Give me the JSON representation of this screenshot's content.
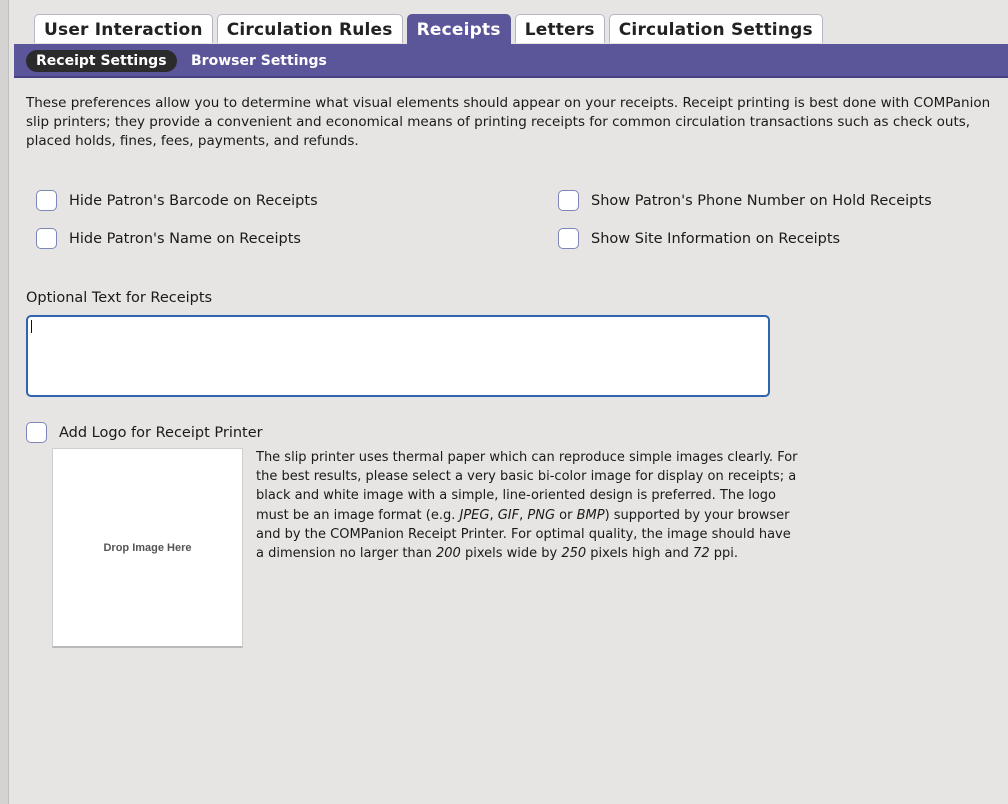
{
  "tabs": [
    "User Interaction",
    "Circulation Rules",
    "Receipts",
    "Letters",
    "Circulation Settings"
  ],
  "active_tab": "Receipts",
  "subtabs": [
    "Receipt Settings",
    "Browser Settings"
  ],
  "active_subtab": "Receipt Settings",
  "description": "These preferences allow you to determine what visual elements should appear on your receipts. Receipt printing is best done with COMPanion slip printers; they provide a convenient and economical means of printing receipts for common circulation transactions such as check outs, placed holds, fines, fees, payments, and refunds.",
  "options": {
    "hide_barcode": "Hide Patron's Barcode on Receipts",
    "hide_name": "Hide Patron's Name on Receipts",
    "show_phone": "Show Patron's Phone Number on Hold Receipts",
    "show_site": "Show Site Information on Receipts"
  },
  "optional_text": {
    "label": "Optional Text for Receipts",
    "value": ""
  },
  "logo": {
    "label": "Add Logo for Receipt Printer",
    "dropzone": "Drop Image Here",
    "help": {
      "t1": "The slip printer uses thermal paper which can reproduce simple images clearly. For the best results, please select a very basic bi-color image for display on receipts; a black and white image with a simple, line-oriented design is preferred. The logo must be an image format (e.g. ",
      "jpeg": "JPEG",
      "sep1": ", ",
      "gif": "GIF",
      "sep2": ", ",
      "png": "PNG",
      "or": " or ",
      "bmp": "BMP",
      "t2": ") supported by your browser and by the COMPanion Receipt Printer. For optimal quality, the image should have a dimension no larger than ",
      "w": "200",
      "t3": " pixels wide by ",
      "h": "250",
      "t4": " pixels high and ",
      "ppi": "72",
      "t5": " ppi."
    }
  }
}
